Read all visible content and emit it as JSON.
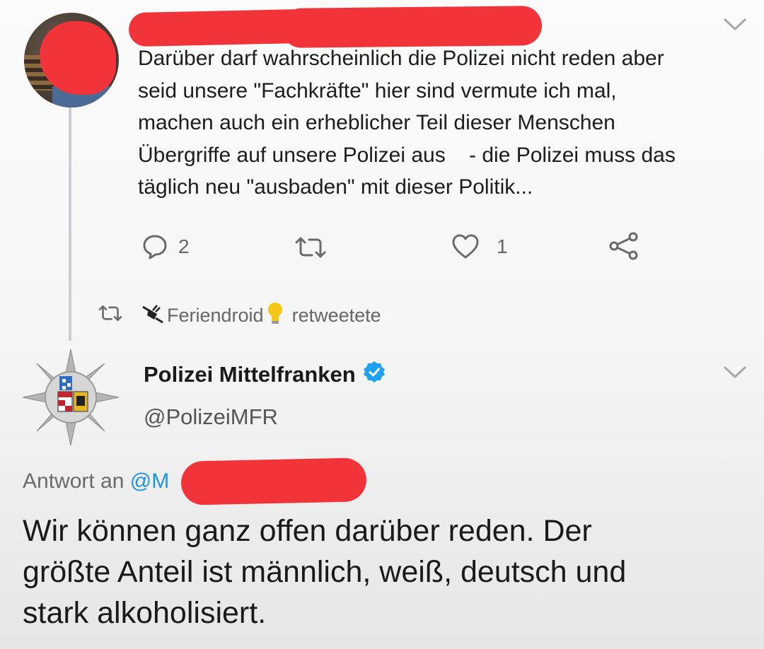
{
  "tweet1": {
    "handle_visible": "@",
    "lines": [
      "Darüber darf wahrscheinlich die Polizei nicht reden aber",
      "seid unsere \"Fachkräfte\" hier sind vermute ich mal,",
      "machen auch ein erheblicher Teil dieser Menschen",
      "Übergriffe auf unsere Polizei aus    - die Polizei muss das",
      "täglich neu \"ausbaden\" mit dieser Politik..."
    ],
    "reply_count": "2",
    "like_count": "1"
  },
  "retweet_notice": {
    "user": "Feriendroid",
    "action": "retweetete"
  },
  "tweet2": {
    "display_name": "Polizei Mittelfranken",
    "handle": "@PolizeiMFR",
    "reply_prefix": "Antwort an ",
    "reply_mention_visible": "@M",
    "lines": [
      "Wir können ganz offen darüber reden. Der",
      "größte Anteil ist männlich, weiß, deutsch und",
      "stark alkoholisiert."
    ]
  },
  "colors": {
    "redaction": "#f0343a",
    "verified": "#1da1f2",
    "mention": "#1b95e0"
  },
  "icons": [
    "reply-icon",
    "retweet-icon",
    "like-icon",
    "share-icon",
    "chevron-down-icon",
    "verified-icon",
    "plug-icon",
    "lightbulb-icon"
  ]
}
